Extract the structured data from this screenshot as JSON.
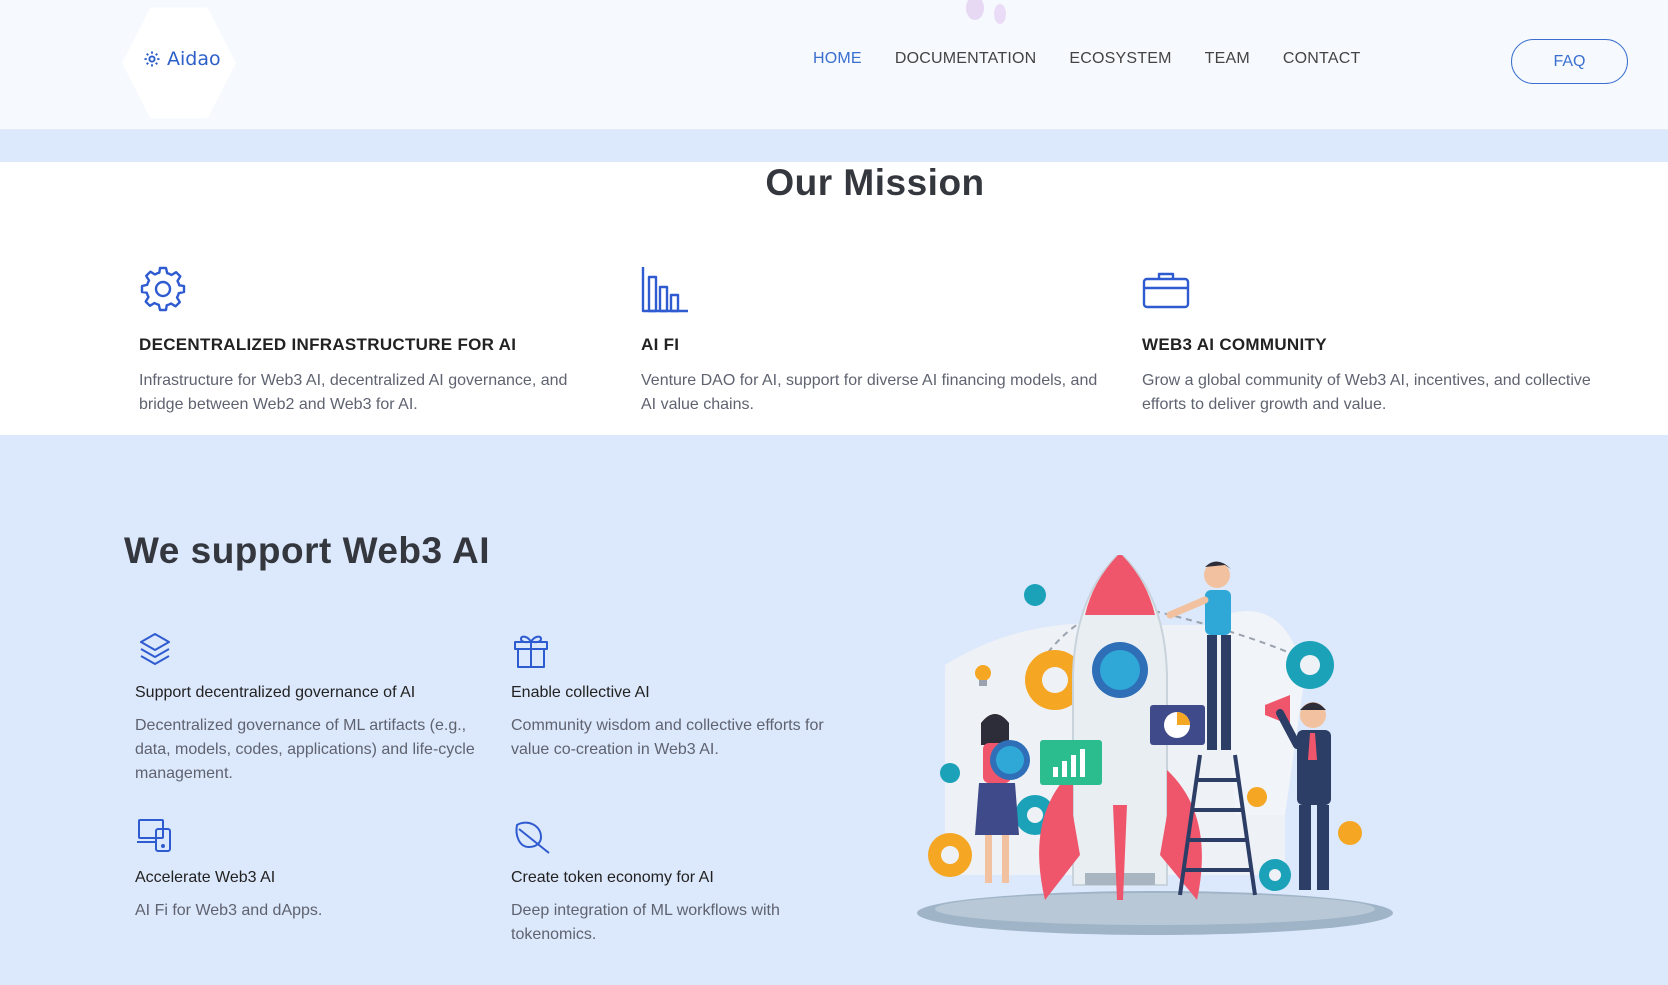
{
  "header": {
    "logo_text": "Aidao",
    "nav": [
      {
        "label": "HOME",
        "active": true
      },
      {
        "label": "DOCUMENTATION",
        "active": false
      },
      {
        "label": "ECOSYSTEM",
        "active": false
      },
      {
        "label": "TEAM",
        "active": false
      },
      {
        "label": "CONTACT",
        "active": false
      }
    ],
    "faq_label": "FAQ"
  },
  "mission": {
    "title": "Our Mission",
    "cards": [
      {
        "icon": "gear-icon",
        "title": "DECENTRALIZED INFRASTRUCTURE FOR AI",
        "text": "Infrastructure for Web3 AI, decentralized AI governance, and bridge between Web2 and Web3 for AI."
      },
      {
        "icon": "bar-chart-icon",
        "title": "AI FI",
        "text": "Venture DAO for AI, support for diverse AI financing models, and AI value chains."
      },
      {
        "icon": "briefcase-icon",
        "title": "WEB3 AI COMMUNITY",
        "text": "Grow a global community of Web3 AI, incentives, and collective efforts to deliver growth and value."
      }
    ]
  },
  "support": {
    "title": "We support Web3 AI",
    "cards": [
      {
        "icon": "layers-icon",
        "title": "Support decentralized governance of AI",
        "text": "Decentralized governance of ML artifacts (e.g., data, models, codes, applications) and life-cycle management."
      },
      {
        "icon": "gift-icon",
        "title": "Enable collective AI",
        "text": "Community wisdom and collective efforts for value co-creation in Web3 AI."
      },
      {
        "icon": "devices-icon",
        "title": "Accelerate Web3 AI",
        "text": "AI Fi for Web3 and dApps."
      },
      {
        "icon": "leaf-icon",
        "title": "Create token economy for AI",
        "text": "Deep integration of ML workflows with tokenomics."
      }
    ]
  },
  "colors": {
    "accent": "#2f5bd0",
    "band": "#dce8fb",
    "heading": "#34373e"
  }
}
